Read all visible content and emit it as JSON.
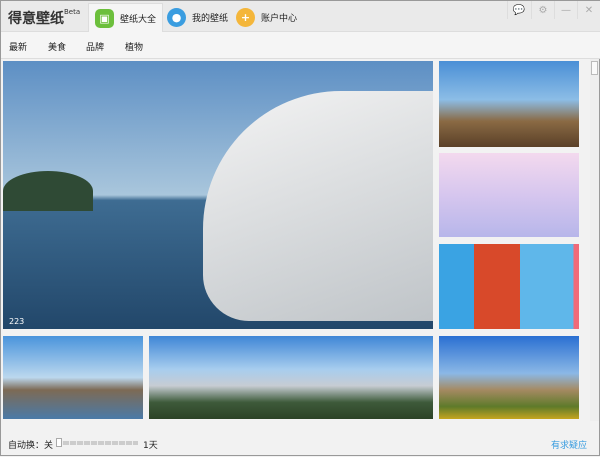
{
  "app": {
    "title": "得意壁纸",
    "badge": "Beta"
  },
  "tabs": [
    {
      "label": "壁纸大全",
      "icon": "image-icon",
      "color": "#6cbf3c",
      "active": true
    },
    {
      "label": "我的壁纸",
      "icon": "user-icon",
      "color": "#3a9de0"
    },
    {
      "label": "账户中心",
      "icon": "plus-icon",
      "color": "#f4b63a"
    }
  ],
  "window": {
    "feedback": "💬",
    "settings": "⚙",
    "minimize": "—",
    "close": "✕"
  },
  "nav": [
    "最新",
    "美食",
    "品牌",
    "植物"
  ],
  "gallery": {
    "main_count": "223"
  },
  "footer": {
    "auto_label": "自动换：关",
    "slider_end": "1天",
    "slider_value": 0,
    "help": "有求疑应"
  },
  "colors": {
    "link": "#3a9de0"
  }
}
